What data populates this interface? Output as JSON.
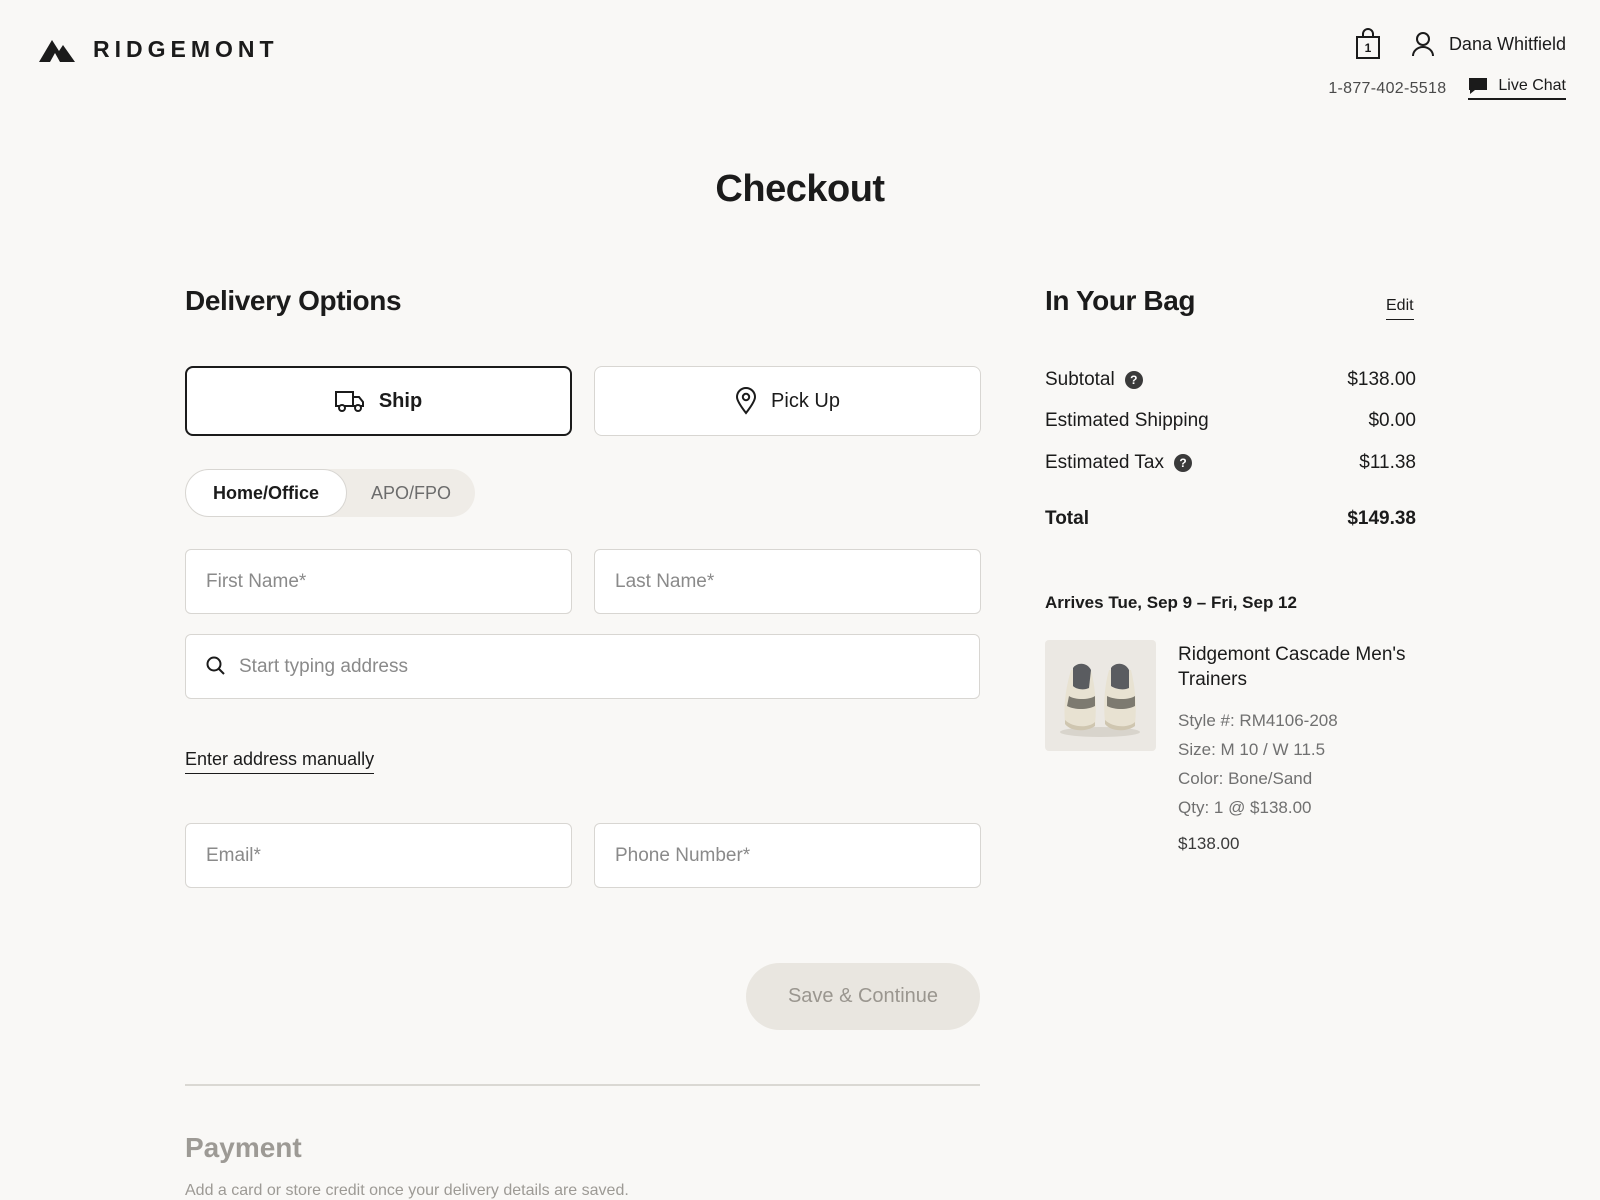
{
  "header": {
    "brand": "RIDGEMONT",
    "bag_count": "1",
    "user_name": "Dana Whitfield",
    "phone": "1-877-402-5518",
    "live_chat": "Live Chat"
  },
  "page_title": "Checkout",
  "delivery": {
    "title": "Delivery Options",
    "options": [
      {
        "label": "Ship",
        "icon": "truck-icon",
        "selected": true
      },
      {
        "label": "Pick Up",
        "icon": "location-pin-icon",
        "selected": false
      }
    ],
    "address_types": [
      {
        "label": "Home/Office",
        "selected": true
      },
      {
        "label": "APO/FPO",
        "selected": false
      }
    ],
    "fields": {
      "first_name": {
        "placeholder": "First Name*",
        "value": ""
      },
      "last_name": {
        "placeholder": "Last Name*",
        "value": ""
      },
      "address": {
        "placeholder": "Start typing address",
        "value": ""
      },
      "email": {
        "placeholder": "Email*",
        "value": ""
      },
      "phone": {
        "placeholder": "Phone Number*",
        "value": ""
      }
    },
    "manual_link": "Enter address manually",
    "save_button": "Save & Continue"
  },
  "payment": {
    "title": "Payment",
    "note": "Add a card or store credit once your delivery details are saved."
  },
  "bag": {
    "title": "In Your Bag",
    "edit": "Edit",
    "summary": {
      "subtotal_label": "Subtotal",
      "subtotal": "$138.00",
      "shipping_label": "Estimated Shipping",
      "shipping": "$0.00",
      "tax_label": "Estimated Tax",
      "tax": "$11.38",
      "total_label": "Total",
      "total": "$149.38"
    },
    "arrival": "Arrives Tue, Sep 9 – Fri, Sep 12",
    "item": {
      "name": "Ridgemont Cascade Men's Trainers",
      "style": "Style #: RM4106-208",
      "size": "Size: M 10 / W 11.5",
      "color": "Color: Bone/Sand",
      "qty": "Qty: 1 @ $138.00",
      "price": "$138.00"
    }
  },
  "colors": {
    "background": "#f9f8f6",
    "text": "#1b1b1b",
    "border": "#d8d6d2",
    "disabled_button": "#e9e6e0",
    "muted": "#9d9a95"
  }
}
